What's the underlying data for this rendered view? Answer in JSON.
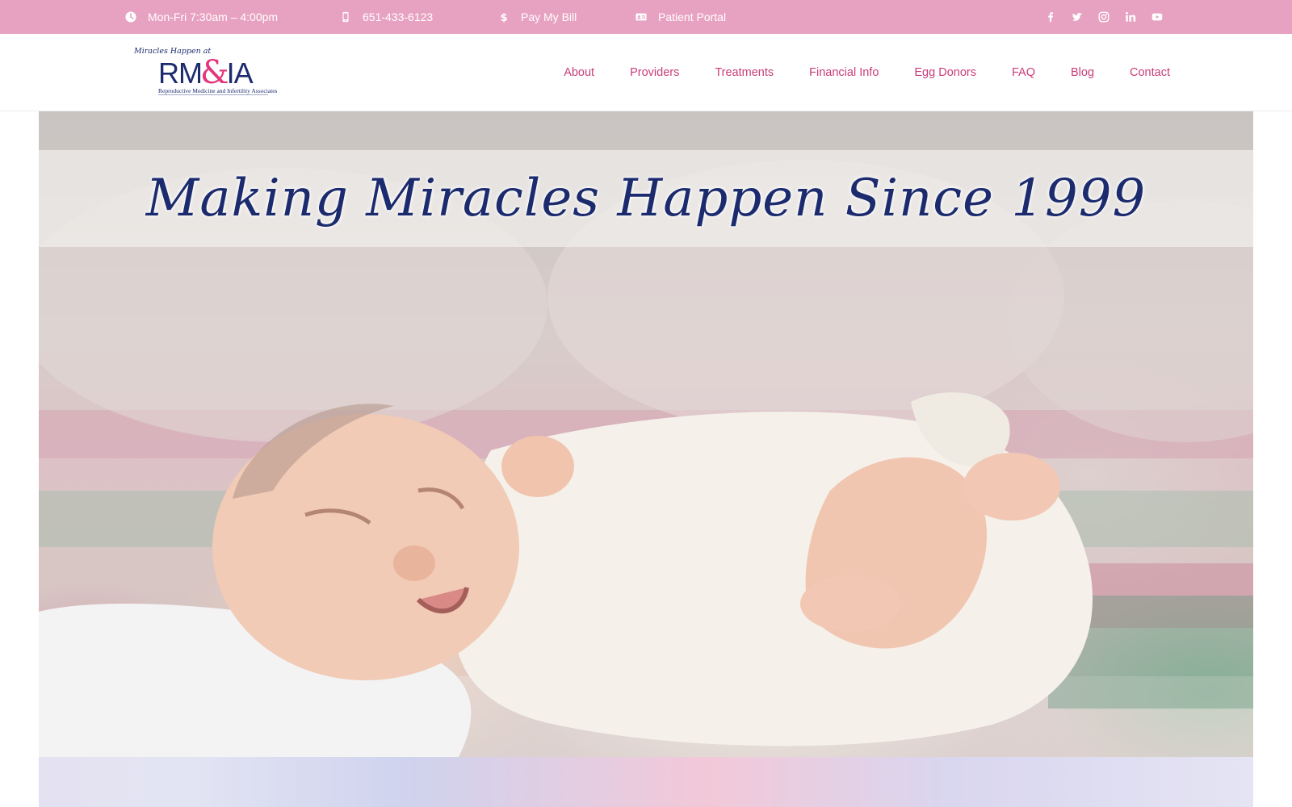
{
  "topbar": {
    "hours": "Mon-Fri 7:30am – 4:00pm",
    "phone": "651-433-6123",
    "pay_bill": "Pay My Bill",
    "patient_portal": "Patient Portal",
    "icons": [
      "clock-icon",
      "mobile-phone-icon",
      "dollar-icon",
      "id-card-icon"
    ],
    "social": [
      "facebook-icon",
      "twitter-icon",
      "instagram-icon",
      "linkedin-icon",
      "youtube-icon"
    ],
    "bg_color": "#e8a2c1"
  },
  "logo": {
    "tagline": "Miracles Happen at",
    "main_left": "RM",
    "amp": "&",
    "main_right": "IA",
    "subtitle": "Reproductive Medicine and Infertility Associates",
    "navy": "#1c2b6e",
    "pink": "#e4367c"
  },
  "nav": {
    "items": [
      "About",
      "Providers",
      "Treatments",
      "Financial Info",
      "Egg Donors",
      "FAQ",
      "Blog",
      "Contact"
    ],
    "color": "#c93d79"
  },
  "hero": {
    "title": "Making Miracles Happen Since 1999",
    "image_alt": "sleeping newborn baby wrapped in white blanket"
  }
}
